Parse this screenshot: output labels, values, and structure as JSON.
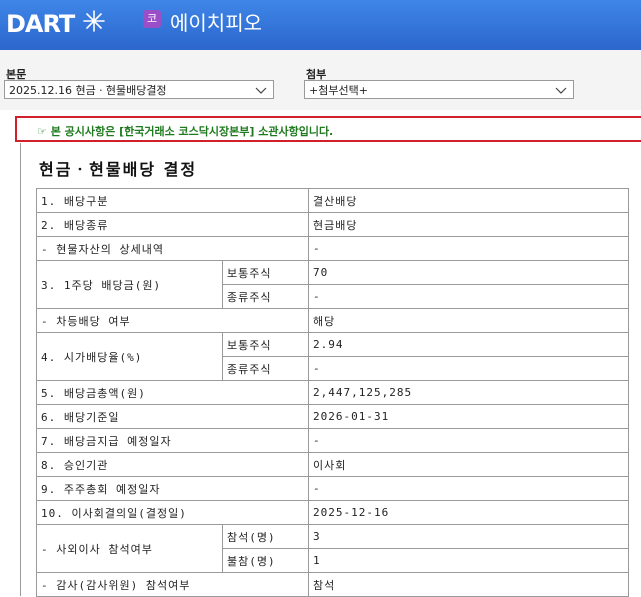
{
  "header": {
    "logo_text": "DART",
    "company_badge": "코",
    "company_name": "에이치피오"
  },
  "toolbar": {
    "body_label": "본문",
    "body_select_value": "2025.12.16  현금ㆍ현물배당결정",
    "attach_label": "첨부",
    "attach_select_value": "+첨부선택+"
  },
  "notice": {
    "text": "☞ 본 공시사항은 [한국거래소 코스닥시장본부] 소관사항입니다."
  },
  "doc": {
    "title": "현금ㆍ현물배당 결정",
    "rows": {
      "r1": {
        "label": "1. 배당구분",
        "value": "결산배당"
      },
      "r2": {
        "label": "2. 배당종류",
        "value": "현금배당"
      },
      "r3": {
        "label": "- 현물자산의 상세내역",
        "value": "-"
      },
      "r4": {
        "label": "3. 1주당 배당금(원)",
        "sub1": "보통주식",
        "val1": "70",
        "sub2": "종류주식",
        "val2": "-"
      },
      "r5": {
        "label": "- 차등배당 여부",
        "value": "해당"
      },
      "r6": {
        "label": "4. 시가배당율(%)",
        "sub1": "보통주식",
        "val1": "2.94",
        "sub2": "종류주식",
        "val2": "-"
      },
      "r7": {
        "label": "5. 배당금총액(원)",
        "value": "2,447,125,285"
      },
      "r8": {
        "label": "6. 배당기준일",
        "value": "2026-01-31"
      },
      "r9": {
        "label": "7. 배당금지급 예정일자",
        "value": "-"
      },
      "r10": {
        "label": "8. 승인기관",
        "value": "이사회"
      },
      "r11": {
        "label": "9. 주주총회 예정일자",
        "value": "-"
      },
      "r12": {
        "label": "10. 이사회결의일(결정일)",
        "value": "2025-12-16"
      },
      "r13": {
        "label": "- 사외이사 참석여부",
        "sub1": "참석(명)",
        "val1": "3",
        "sub2": "불참(명)",
        "val2": "1"
      },
      "r14": {
        "label": "- 감사(감사위원) 참석여부",
        "value": "참석"
      }
    }
  }
}
